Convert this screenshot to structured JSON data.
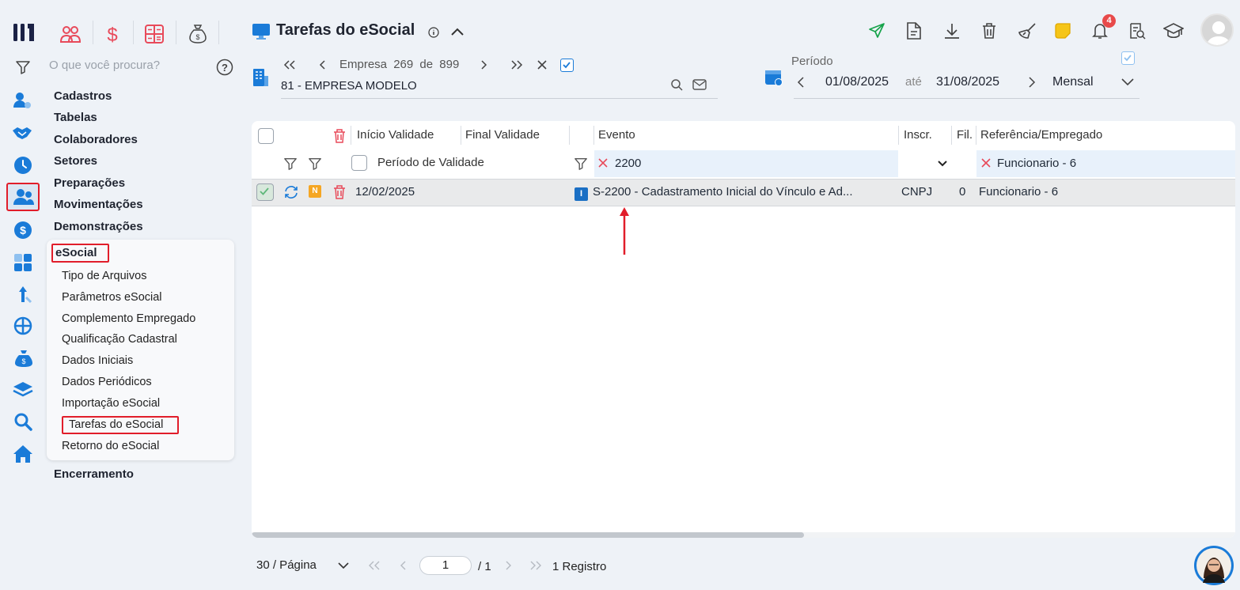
{
  "header": {
    "title": "Tarefas do eSocial",
    "notification_count": "4"
  },
  "search": {
    "placeholder": "O que você procura?"
  },
  "company": {
    "label": "Empresa",
    "current": "269",
    "of": "de",
    "total": "899",
    "name": "81 - EMPRESA MODELO"
  },
  "period": {
    "label": "Período",
    "start": "01/08/2025",
    "until": "até",
    "end": "31/08/2025",
    "mode": "Mensal"
  },
  "menu": {
    "items": [
      "Cadastros",
      "Tabelas",
      "Colaboradores",
      "Setores",
      "Preparações",
      "Movimentações",
      "Demonstrações"
    ],
    "esocial_label": "eSocial",
    "esocial_sub": [
      "Tipo de Arquivos",
      "Parâmetros eSocial",
      "Complemento Empregado",
      "Qualificação Cadastral",
      "Dados Iniciais",
      "Dados Periódicos",
      "Importação eSocial",
      "Tarefas do eSocial",
      "Retorno do eSocial"
    ],
    "last": "Encerramento"
  },
  "table": {
    "columns": {
      "inicio": "Início Validade",
      "final": "Final Validade",
      "evento": "Evento",
      "inscr": "Inscr.",
      "fil": "Fil.",
      "ref": "Referência/Empregado"
    },
    "filters": {
      "periodo": "Período de Validade",
      "evento": "2200",
      "ref": "Funcionario - 6"
    },
    "rows": [
      {
        "status_badge": "N",
        "event_badge": "I",
        "inicio": "12/02/2025",
        "evento": "S-2200 - Cadastramento Inicial do Vínculo e Ad...",
        "inscr": "CNPJ",
        "fil": "0",
        "ref": "Funcionario - 6"
      }
    ]
  },
  "pagination": {
    "per_page": "30 / Página",
    "page": "1",
    "total_pages": "/ 1",
    "records": "1 Registro"
  },
  "colors": {
    "accent": "#1a7bd8",
    "danger": "#e11d2a",
    "send_green": "#16a34a",
    "note_yellow": "#f5c518"
  }
}
